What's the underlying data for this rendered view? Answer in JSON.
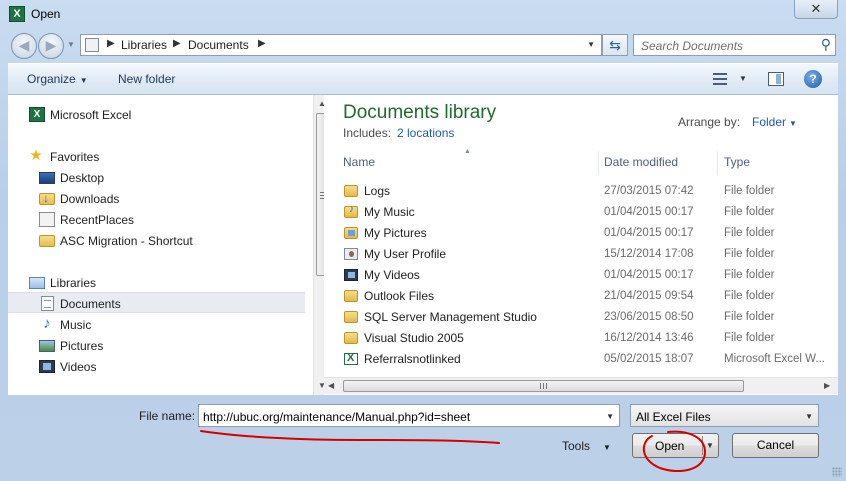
{
  "window": {
    "title": "Open",
    "close_glyph": "✕"
  },
  "address": {
    "crumbs": [
      "Libraries",
      "Documents"
    ],
    "search_placeholder": "Search Documents"
  },
  "toolbar": {
    "organize": "Organize",
    "new_folder": "New folder",
    "help": "?"
  },
  "nav": {
    "items": [
      {
        "label": "Microsoft Excel",
        "icon": "excel-icon"
      },
      {
        "label": "Favorites",
        "icon": "star-icon"
      },
      {
        "label": "Desktop",
        "icon": "desktop-icon"
      },
      {
        "label": "Downloads",
        "icon": "downloads-folder-icon"
      },
      {
        "label": "RecentPlaces",
        "icon": "recent-places-icon"
      },
      {
        "label": "ASC Migration - Shortcut",
        "icon": "folder-shortcut-icon"
      },
      {
        "label": "Libraries",
        "icon": "libraries-icon"
      },
      {
        "label": "Documents",
        "icon": "documents-icon",
        "selected": true
      },
      {
        "label": "Music",
        "icon": "music-icon"
      },
      {
        "label": "Pictures",
        "icon": "pictures-icon"
      },
      {
        "label": "Videos",
        "icon": "videos-icon"
      }
    ]
  },
  "library": {
    "title": "Documents library",
    "includes_label": "Includes:",
    "includes_link": "2 locations",
    "arrange_label": "Arrange by:",
    "arrange_value": "Folder"
  },
  "columns": {
    "name": "Name",
    "date": "Date modified",
    "type": "Type"
  },
  "files": [
    {
      "name": "Logs",
      "date": "27/03/2015 07:42",
      "type": "File folder",
      "icon": "folder-icon"
    },
    {
      "name": "My Music",
      "date": "01/04/2015 00:17",
      "type": "File folder",
      "icon": "music-folder-icon"
    },
    {
      "name": "My Pictures",
      "date": "01/04/2015 00:17",
      "type": "File folder",
      "icon": "pictures-folder-icon"
    },
    {
      "name": "My User Profile",
      "date": "15/12/2014 17:08",
      "type": "File folder",
      "icon": "user-profile-folder-icon"
    },
    {
      "name": "My Videos",
      "date": "01/04/2015 00:17",
      "type": "File folder",
      "icon": "videos-folder-icon"
    },
    {
      "name": "Outlook Files",
      "date": "21/04/2015 09:54",
      "type": "File folder",
      "icon": "folder-icon"
    },
    {
      "name": "SQL Server Management Studio",
      "date": "23/06/2015 08:50",
      "type": "File folder",
      "icon": "folder-icon"
    },
    {
      "name": "Visual Studio 2005",
      "date": "16/12/2014 13:46",
      "type": "File folder",
      "icon": "folder-icon"
    },
    {
      "name": "Referralsnotlinked",
      "date": "05/02/2015 18:07",
      "type": "Microsoft Excel W...",
      "icon": "excel-file-icon"
    }
  ],
  "bottom": {
    "file_name_label": "File name:",
    "file_name_value": "http://ubuc.org/maintenance/Manual.php?id=sheet",
    "filter_value": "All Excel Files",
    "tools_label": "Tools",
    "open_label": "Open",
    "cancel_label": "Cancel"
  },
  "colors": {
    "accent_green": "#1e6b2e",
    "link_blue": "#1e5ba8",
    "annotation_red": "#d40000"
  }
}
